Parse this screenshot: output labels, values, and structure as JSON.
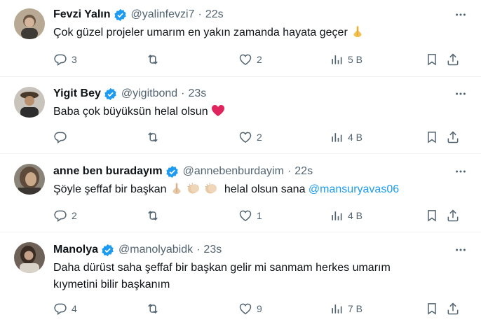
{
  "colors": {
    "verified": "#1d9bf0",
    "mention": "#1d9bf0",
    "muted": "#536471",
    "heart": "#f91880"
  },
  "tweets": [
    {
      "name": "Fevzi Yalın",
      "handle": "@yalinfevzi7",
      "time": "22s",
      "text": "Çok güzel projeler umarım en yakın zamanda hayata geçer",
      "emoji": "folded-hands",
      "replies": "3",
      "retweets": "",
      "likes": "2",
      "views": "5 B"
    },
    {
      "name": "Yigit Bey",
      "handle": "@yigitbond",
      "time": "23s",
      "text": "Baba çok büyüksün helal olsun",
      "emoji": "red-heart",
      "replies": "",
      "retweets": "",
      "likes": "2",
      "views": "4 B"
    },
    {
      "name": "anne ben buradayım",
      "handle": "@annebenburdayim",
      "time": "22s",
      "text_before": "Şöyle şeffaf bir başkan",
      "text_after": " helal olsun sana ",
      "mention": "@mansuryavas06",
      "emoji": "folded-hands-clapping-hands-clapping-hands",
      "replies": "2",
      "retweets": "",
      "likes": "1",
      "views": "4 B"
    },
    {
      "name": "Manolya",
      "handle": "@manolyabidk",
      "time": "23s",
      "text_line1": "Daha dürüst saha şeffaf bir başkan gelir mi sanmam herkes umarım",
      "text_line2": "kıymetini bilir başkanım",
      "replies": "4",
      "retweets": "",
      "likes": "9",
      "views": "7 B"
    }
  ],
  "separator": "·"
}
